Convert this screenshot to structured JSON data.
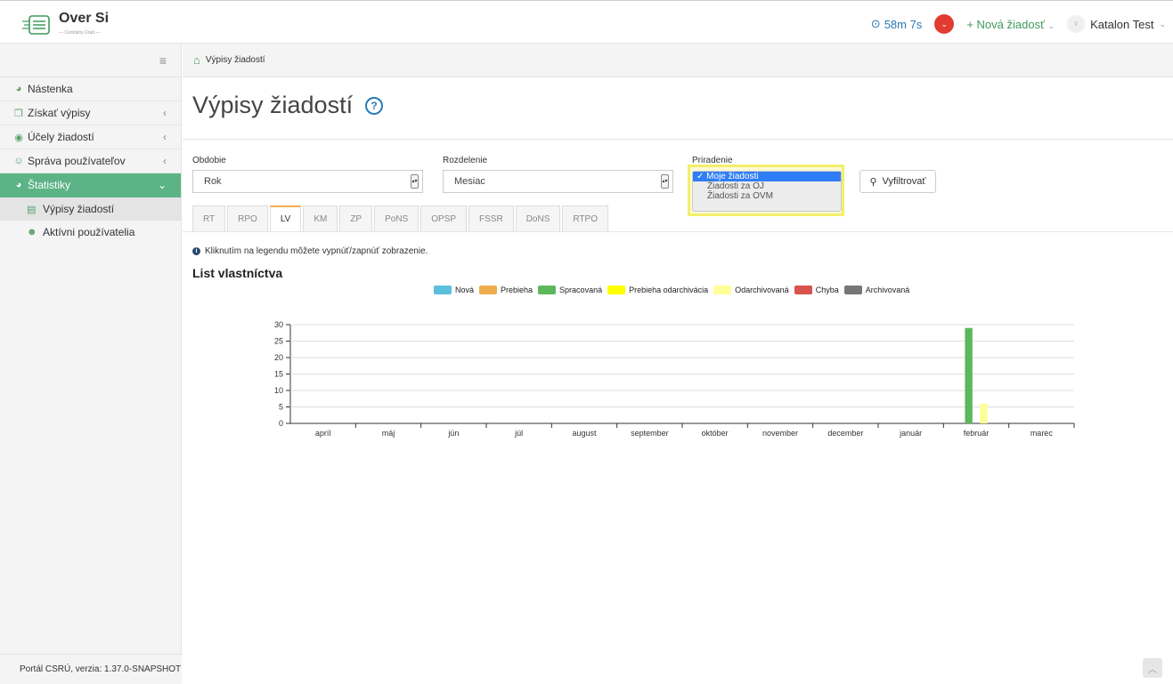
{
  "header": {
    "logo_text": "Over Si",
    "logo_sub": "— Centrálny Úrad —",
    "timer": "58m 7s",
    "new_request": "Nová žiadosť",
    "user_name": "Katalon Test"
  },
  "sidebar": {
    "items": [
      {
        "label": "Nástenka",
        "icon": "dashboard-icon"
      },
      {
        "label": "Získať výpisy",
        "icon": "copy-icon"
      },
      {
        "label": "Účely žiadostí",
        "icon": "target-icon"
      },
      {
        "label": "Správa používateľov",
        "icon": "users-icon"
      },
      {
        "label": "Štatistiky",
        "icon": "dashboard-icon"
      }
    ],
    "sub_items": [
      {
        "label": "Výpisy žiadostí",
        "icon": "map-icon"
      },
      {
        "label": "Aktívni používatelia",
        "icon": "group-icon"
      }
    ],
    "footer": "Portál CSRÚ, verzia: 1.37.0-SNAPSHOT"
  },
  "breadcrumb": {
    "current": "Výpisy žiadostí"
  },
  "page": {
    "title": "Výpisy žiadostí"
  },
  "filters": {
    "period_label": "Obdobie",
    "period_value": "Rok",
    "split_label": "Rozdelenie",
    "split_value": "Mesiac",
    "assign_label": "Priradenie",
    "assign_options": [
      "Moje žiadosti",
      "Žiadosti za OJ",
      "Žiadosti za OVM"
    ],
    "assign_selected_mark": "✓",
    "filter_button": "Vyfiltrovať"
  },
  "tabs": [
    "RT",
    "RPO",
    "LV",
    "KM",
    "ZP",
    "PoNS",
    "OPSP",
    "FSSR",
    "DoNS",
    "RTPO"
  ],
  "active_tab": "LV",
  "info_text": "Kliknutím na legendu môžete vypnúť/zapnúť zobrazenie.",
  "chart_data": {
    "type": "bar",
    "title": "List vlastníctva",
    "categories": [
      "apríl",
      "máj",
      "jún",
      "júl",
      "august",
      "september",
      "október",
      "november",
      "december",
      "január",
      "február",
      "marec"
    ],
    "series": [
      {
        "name": "Nová",
        "color": "#5bc0de",
        "values": [
          0,
          0,
          0,
          0,
          0,
          0,
          0,
          0,
          0,
          0,
          0,
          0
        ]
      },
      {
        "name": "Prebieha",
        "color": "#f0ad4e",
        "values": [
          0,
          0,
          0,
          0,
          0,
          0,
          0,
          0,
          0,
          0,
          0,
          0
        ]
      },
      {
        "name": "Spracovaná",
        "color": "#5cb85c",
        "values": [
          0,
          0,
          0,
          0,
          0,
          0,
          0,
          0,
          0,
          0,
          29,
          0
        ]
      },
      {
        "name": "Prebieha odarchivácia",
        "color": "#ffff00",
        "values": [
          0,
          0,
          0,
          0,
          0,
          0,
          0,
          0,
          0,
          0,
          0,
          0
        ]
      },
      {
        "name": "Odarchivovaná",
        "color": "#ffff99",
        "values": [
          0,
          0,
          0,
          0,
          0,
          0,
          0,
          0,
          0,
          0,
          6,
          0
        ]
      },
      {
        "name": "Chyba",
        "color": "#d9534f",
        "values": [
          0,
          0,
          0,
          0,
          0,
          0,
          0,
          0,
          0,
          0,
          0,
          0
        ]
      },
      {
        "name": "Archivovaná",
        "color": "#777777",
        "values": [
          0,
          0,
          0,
          0,
          0,
          0,
          0,
          0,
          0,
          0,
          0,
          0
        ]
      }
    ],
    "y_ticks": [
      0,
      5,
      10,
      15,
      20,
      25,
      30
    ],
    "ylim": [
      0,
      30
    ],
    "grid": true,
    "legend_position": "top-center"
  }
}
